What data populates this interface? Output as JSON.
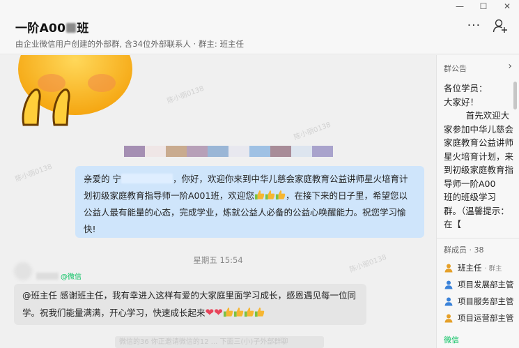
{
  "window": {
    "controls": [
      "—",
      "☐",
      "✕"
    ]
  },
  "header": {
    "title_prefix": "一阶A00",
    "title_suffix": "班",
    "subtitle": "由企业微信用户创建的外部群, 含34位外部联系人 · 群主: 班主任",
    "more_label": "···"
  },
  "chat": {
    "message_self": {
      "part1": "亲爱的 宁",
      "part2": "，你好，欢迎你来到中华儿慈会家庭教育公益讲师星火培育计划初级家庭教育指导师一阶A001",
      "part3": "班，欢迎您",
      "part4": "，在接下来的日子里，希望您以公益人最有能量的心态，完成学业，炼就公益人必备的公益心唤醒能力。祝您学习愉快!"
    },
    "timestamp": "星期五 15:54",
    "sender_suffix": "@微信",
    "message_other": {
      "text": "@班主任 感谢班主任，我有幸进入这样有爱的大家庭里面学习成长，感恩遇见每一位同学。祝我们能量满满，开心学习，快速成长起来"
    },
    "bottom_strip": "微信的36  你正邀请微信的12 ...  下面三(小)子外部群聊",
    "watermark": "陈小丽0138"
  },
  "sidebar": {
    "announcement_header": "群公告",
    "announcement_lines": [
      "各位学员：",
      "大家好！",
      "        首先欢迎大家参加中华儿慈会家庭教育公益讲师星火培育计划，来到初级家庭教育指导师一阶A00",
      "班的班级学习群。（温馨提示：在【"
    ],
    "members_header": "群成员 · 38",
    "members": [
      {
        "name": "班主任",
        "role": "· 群主",
        "color": "#e5a029"
      },
      {
        "name": "项目发展部主管",
        "role": "",
        "color": "#3a82d9"
      },
      {
        "name": "项目服务部主管",
        "role": "",
        "color": "#3a82d9"
      },
      {
        "name": "项目运营部主管",
        "role": "",
        "color": "#e5a029"
      }
    ],
    "wechat_label": "微信"
  },
  "colors": {
    "self_bubble": "#cfe5fb",
    "other_bubble": "#e5e5e5",
    "accent_green": "#07c160"
  }
}
